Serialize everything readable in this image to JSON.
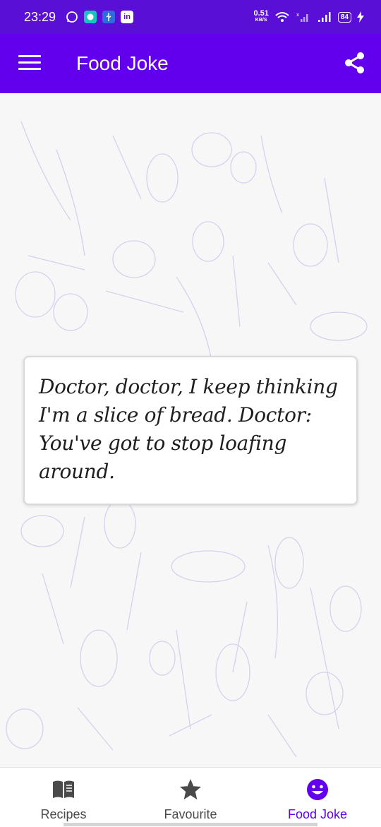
{
  "status_bar": {
    "time": "23:29",
    "net_speed_value": "0.51",
    "net_speed_unit": "KB/S",
    "battery": "84",
    "notification_icons": [
      "whatsapp-icon",
      "messages-icon",
      "usb-icon",
      "linkedin-icon"
    ]
  },
  "app_bar": {
    "title": "Food Joke",
    "menu_icon": "hamburger-menu-icon",
    "share_icon": "share-icon"
  },
  "joke": {
    "text": "Doctor, doctor, I keep thinking I'm a slice of bread. Doctor: You've got to stop loafing around."
  },
  "bottom_nav": {
    "items": [
      {
        "label": "Recipes",
        "icon": "book-icon",
        "active": false
      },
      {
        "label": "Favourite",
        "icon": "star-icon",
        "active": false
      },
      {
        "label": "Food Joke",
        "icon": "smiley-icon",
        "active": true
      }
    ]
  },
  "colors": {
    "status_bar": "#5a0fd6",
    "app_bar": "#6200ee",
    "active_nav": "#6200ee",
    "inactive_nav": "#4a4a4a"
  }
}
